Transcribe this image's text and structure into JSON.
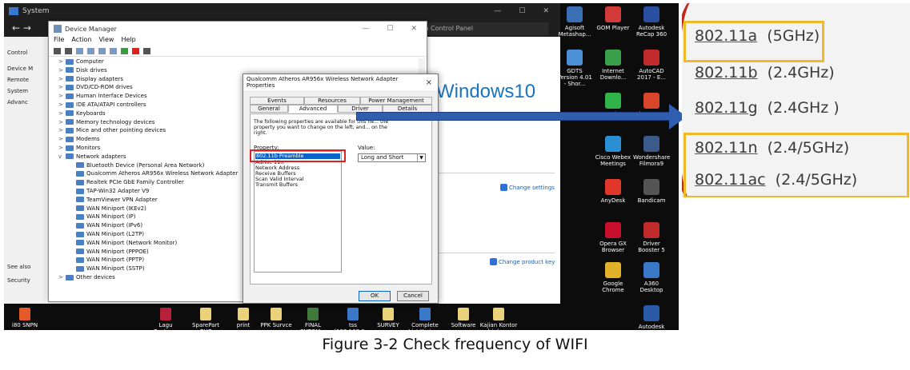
{
  "system_window": {
    "title": "System",
    "nav_arrows": "←  →",
    "search_placeholder": "ch Control Panel",
    "left_labels": [
      "Control",
      "Device M",
      "Remote",
      "System",
      "Advanc",
      "See also",
      "Security"
    ],
    "brand": "Windows10",
    "change_settings": "Change settings",
    "change_product_key": "Change product key"
  },
  "device_manager": {
    "title": "Device Manager",
    "menu": [
      "File",
      "Action",
      "View",
      "Help"
    ],
    "tree": [
      {
        "label": "Computer",
        "expand": ">"
      },
      {
        "label": "Disk drives",
        "expand": ">"
      },
      {
        "label": "Display adapters",
        "expand": ">"
      },
      {
        "label": "DVD/CD-ROM drives",
        "expand": ">"
      },
      {
        "label": "Human Interface Devices",
        "expand": ">"
      },
      {
        "label": "IDE ATA/ATAPI controllers",
        "expand": ">"
      },
      {
        "label": "Keyboards",
        "expand": ">"
      },
      {
        "label": "Memory technology devices",
        "expand": ">"
      },
      {
        "label": "Mice and other pointing devices",
        "expand": ">"
      },
      {
        "label": "Modems",
        "expand": ">"
      },
      {
        "label": "Monitors",
        "expand": ">"
      },
      {
        "label": "Network adapters",
        "expand": "v"
      }
    ],
    "network_children": [
      "Bluetooth Device (Personal Area Network)",
      "Qualcomm Atheros AR956x Wireless Network Adapter",
      "Realtek PCIe GbE Family Controller",
      "TAP-Win32 Adapter V9",
      "TeamViewer VPN Adapter",
      "WAN Miniport (IKEv2)",
      "WAN Miniport (IP)",
      "WAN Miniport (IPv6)",
      "WAN Miniport (L2TP)",
      "WAN Miniport (Network Monitor)",
      "WAN Miniport (PPPOE)",
      "WAN Miniport (PPTP)",
      "WAN Miniport (SSTP)"
    ],
    "tree_last": "Other devices"
  },
  "properties_dialog": {
    "title": "Qualcomm Atheros AR956x Wireless Network Adapter Properties",
    "close": "×",
    "tabs_row1": [
      "Events",
      "Resources",
      "Power Management"
    ],
    "tabs_row2": [
      "General",
      "Advanced",
      "Driver",
      "Details"
    ],
    "intro": "The following properties are available for this ne... the property you want to change on the left, and... on the right.",
    "property_label": "Property:",
    "value_label": "Value:",
    "properties": [
      "802.11b Preamble",
      "AdHoc 11n",
      "Network Address",
      "Receive Buffers",
      "Scan Valid Interval",
      "Transmit Buffers"
    ],
    "value": "Long and Short",
    "ok": "OK",
    "cancel": "Cancel"
  },
  "desktop_icons": [
    {
      "label": "Agisoft Metashap...",
      "color": "#3a6fb5"
    },
    {
      "label": "GOM Player",
      "color": "#d23a3a"
    },
    {
      "label": "Autodesk ReCap 360",
      "color": "#2a4fa0"
    },
    {
      "label": "GDTS Version 4.01 - Shor...",
      "color": "#4b8fd6"
    },
    {
      "label": "Internet Downlo...",
      "color": "#3aa04a"
    },
    {
      "label": "AutoCAD 2017 - E...",
      "color": "#c22b2b"
    },
    {
      "label": "WeChat",
      "color": "#2fb34a"
    },
    {
      "label": "Nitro Pro 10",
      "color": "#d8452a"
    },
    {
      "label": "Cisco Webex Meetings",
      "color": "#2b8fd4"
    },
    {
      "label": "Wondershare Filmora9",
      "color": "#3c5a8a"
    },
    {
      "label": "AnyDesk",
      "color": "#e0372a"
    },
    {
      "label": "Bandicam",
      "color": "#555555"
    },
    {
      "label": "Opera GX Browser",
      "color": "#c8102e"
    },
    {
      "label": "Driver Booster 5",
      "color": "#c22b2b"
    },
    {
      "label": "Google Chrome",
      "color": "#e2b12a"
    },
    {
      "label": "A360 Desktop",
      "color": "#3a78c8"
    },
    {
      "label": "Autodesk Desktop App",
      "color": "#2a5aa8"
    }
  ],
  "taskbar_items": [
    {
      "label": "i80 SNPN",
      "color": "#e65a2a"
    },
    {
      "label": "Lagu Best.asx",
      "color": "#b8203a"
    },
    {
      "label": "SparePart CHC",
      "color": "#e9d27a"
    },
    {
      "label": "print",
      "color": "#e9d27a"
    },
    {
      "label": "PPK Survce",
      "color": "#e9d27a"
    },
    {
      "label": "FINAL PNTOM...",
      "color": "#3f7a3a"
    },
    {
      "label": "tss (192.168.0....",
      "color": "#3a78c8"
    },
    {
      "label": "SURVEY",
      "color": "#e9d27a"
    },
    {
      "label": "Complete List Kerja ...",
      "color": "#3a78c8"
    },
    {
      "label": "Software",
      "color": "#e9d27a"
    },
    {
      "label": "Kajian Kontor dri drone",
      "color": "#e9d27a"
    }
  ],
  "zoom_panel": {
    "rows": [
      {
        "std": "802.11a",
        "band": "(5GHz)"
      },
      {
        "std": "802.11b",
        "band": "(2.4GHz)"
      },
      {
        "std": "802.11g",
        "band": "(2.4GHz )"
      },
      {
        "std": "802.11n",
        "band": "(2.4/5GHz)"
      },
      {
        "std": "802.11ac",
        "band": "(2.4/5GHz)"
      }
    ],
    "highlight_color": "#f0b928"
  },
  "caption": "Figure 3-2 Check frequency of WIFI"
}
